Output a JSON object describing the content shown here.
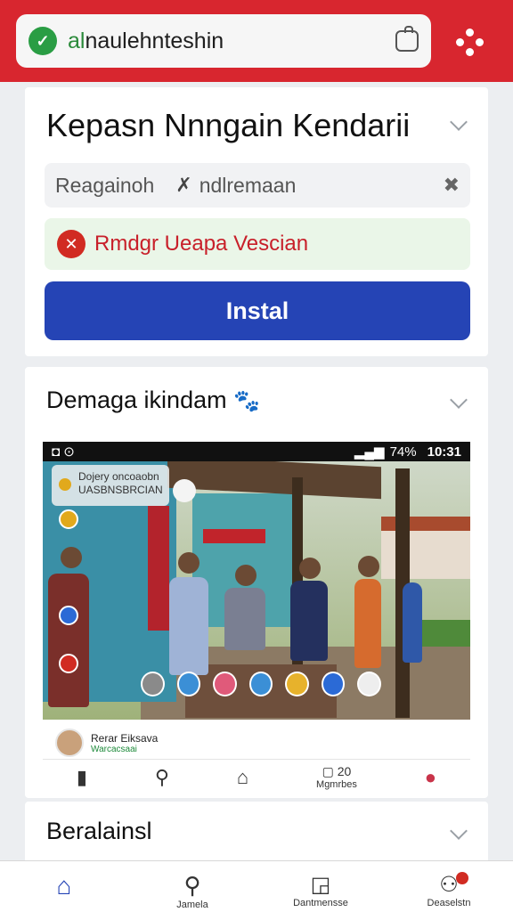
{
  "browser": {
    "url_prefix": "al",
    "url_rest": "naulehnteshin"
  },
  "card1": {
    "title": "Kepasn Nnngain Kendarii",
    "filter_left": "Reagainoh",
    "filter_right": "ndlremaan",
    "alert_text": "Rmdgr Ueapa Vescian",
    "install_label": "Instal"
  },
  "card2": {
    "title": "Demaga ikindam",
    "title_emoji": "🐾",
    "status_time": "10:31",
    "status_battery": "74%",
    "overlay_line1": "Dojery oncoaobn",
    "overlay_line2": "UASBNSBRCIAN",
    "author_name": "Rerar Eiksava",
    "author_sub": "Warcacsaai",
    "inner_nav_count": "20",
    "inner_nav_label": "Mgmrbes"
  },
  "card3": {
    "title": "Beralainsl"
  },
  "colors": {
    "topbar": "#d8262f",
    "install_button": "#2544b5",
    "alert_text": "#c8202a",
    "alert_bg": "#eaf6e8"
  },
  "bottom_nav": {
    "items": [
      {
        "icon": "home-icon",
        "label": ""
      },
      {
        "icon": "search-icon",
        "label": "Jamela"
      },
      {
        "icon": "photo-icon",
        "label": "Dantmensse"
      },
      {
        "icon": "profile-icon",
        "label": "Deaselstn"
      }
    ]
  }
}
